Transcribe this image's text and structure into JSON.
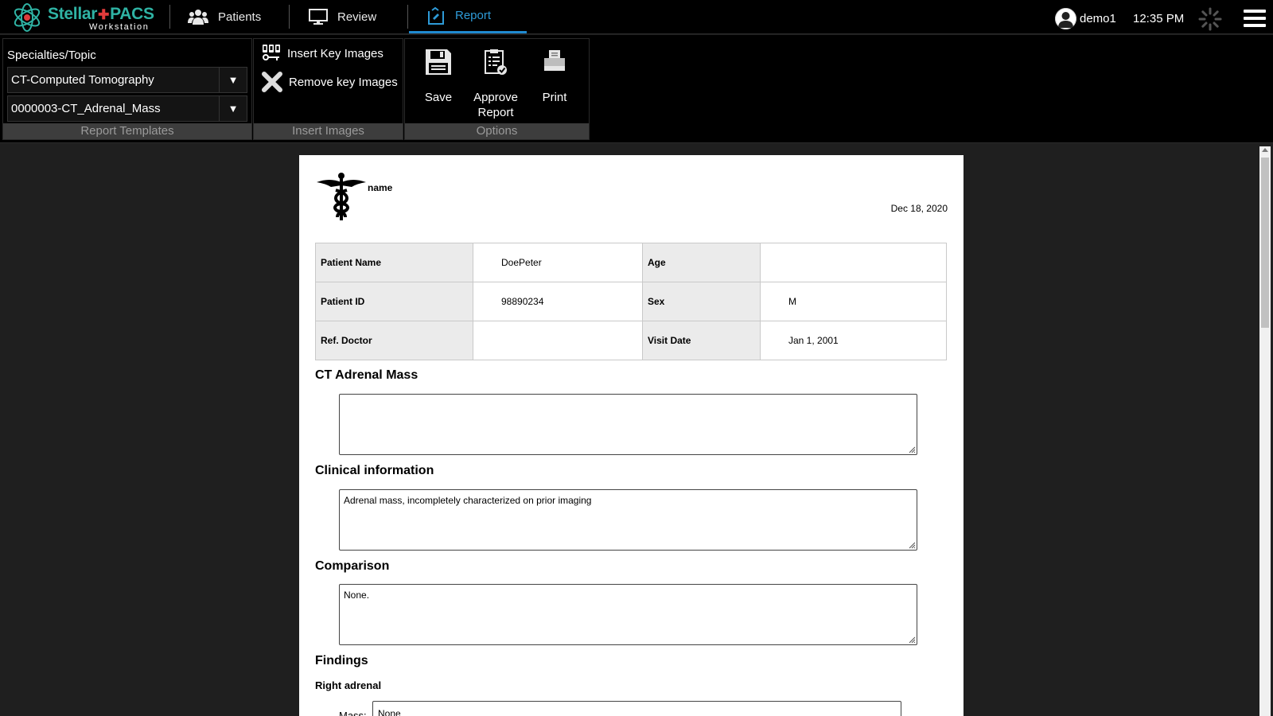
{
  "app": {
    "brand": "Stellar",
    "brand_accent": "PACS",
    "subtitle": "Workstation",
    "brand_color": "#2fb3a4",
    "accent_color": "#1f8ad0"
  },
  "nav": {
    "tabs": [
      {
        "label": "Patients",
        "icon": "patients-icon"
      },
      {
        "label": "Review",
        "icon": "monitor-icon"
      },
      {
        "label": "Report",
        "icon": "report-icon",
        "active": true
      }
    ]
  },
  "header": {
    "username": "demo1",
    "time": "12:35 PM"
  },
  "ribbon": {
    "report_templates": {
      "group_label": "Report Templates",
      "specialty_label": "Specialties/Topic",
      "specialty_value": "CT-Computed Tomography",
      "template_value": "0000003-CT_Adrenal_Mass"
    },
    "insert_images": {
      "group_label": "Insert Images",
      "insert_label": "Insert Key Images",
      "remove_label": "Remove key Images"
    },
    "options": {
      "group_label": "Options",
      "save_label": "Save",
      "approve_label": "Approve Report",
      "print_label": "Print"
    }
  },
  "report": {
    "institution_name": "name",
    "date": "Dec 18, 2020",
    "patient": {
      "name_label": "Patient Name",
      "name_value": "DoePeter",
      "age_label": "Age",
      "age_value": "",
      "id_label": "Patient ID",
      "id_value": "98890234",
      "sex_label": "Sex",
      "sex_value": "M",
      "ref_doctor_label": "Ref. Doctor",
      "ref_doctor_value": "",
      "visit_date_label": "Visit Date",
      "visit_date_value": "Jan 1, 2001"
    },
    "sections": {
      "ct_adrenal_mass": {
        "title": "CT Adrenal Mass",
        "value": ""
      },
      "clinical_information": {
        "title": "Clinical information",
        "value": "Adrenal mass, incompletely characterized on prior imaging"
      },
      "comparison": {
        "title": "Comparison",
        "value": "None."
      },
      "findings": {
        "title": "Findings",
        "subsection": "Right adrenal",
        "mass_label": "Mass:",
        "mass_value": "None"
      }
    }
  }
}
